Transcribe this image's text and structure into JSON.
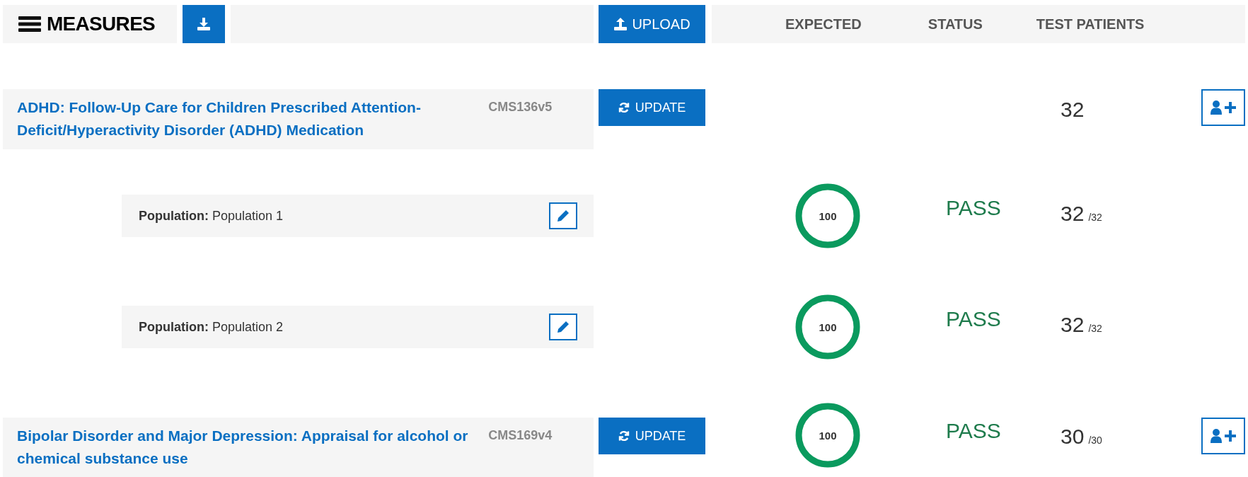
{
  "header": {
    "title": "MEASURES",
    "upload_label": "UPLOAD",
    "columns": [
      "EXPECTED",
      "STATUS",
      "TEST PATIENTS"
    ]
  },
  "measures": [
    {
      "title": "ADHD: Follow-Up Care for Children Prescribed Attention-Deficit/Hyperactivity Disorder (ADHD) Medication",
      "cms": "CMS136v5",
      "update_label": "UPDATE",
      "patients": "32",
      "children": [
        {
          "label": "Population:",
          "name": "Population 1",
          "expected": "100",
          "status": "PASS",
          "passed": true,
          "patients": "32",
          "patients_total": "/32"
        },
        {
          "label": "Population:",
          "name": "Population 2",
          "expected": "100",
          "status": "PASS",
          "passed": true,
          "patients": "32",
          "patients_total": "/32"
        }
      ]
    },
    {
      "title": "Bipolar Disorder and Major Depression: Appraisal for alcohol or chemical substance use",
      "cms": "CMS169v4",
      "update_label": "UPDATE",
      "expected": "100",
      "status": "PASS",
      "passed": true,
      "patients": "30",
      "patients_total": "/30"
    }
  ]
}
